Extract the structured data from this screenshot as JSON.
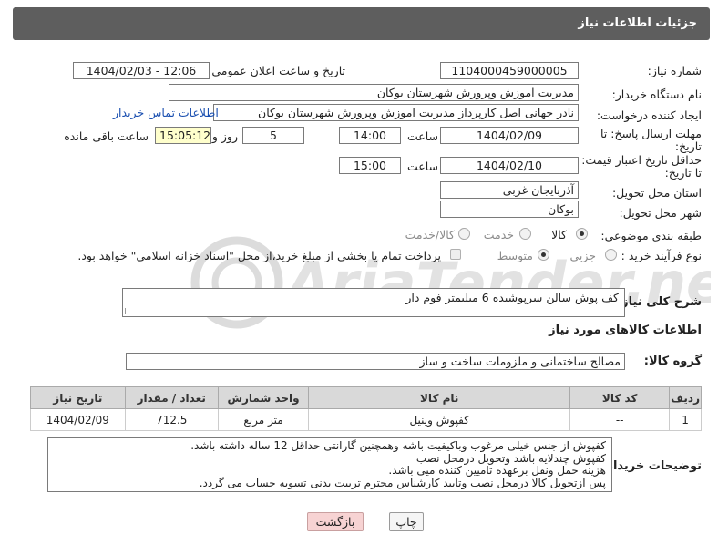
{
  "header": {
    "title": "جزئیات اطلاعات نیاز"
  },
  "form": {
    "need_number_label": "شماره نیاز:",
    "need_number": "1104000459000005",
    "announce_label": "تاریخ و ساعت اعلان عمومی:",
    "announce_value": "1404/02/03 - 12:06",
    "buyer_label": "نام دستگاه خریدار:",
    "buyer_value": "مدیریت اموزش وپرورش شهرستان بوکان",
    "creator_label": "ایجاد کننده درخواست:",
    "creator_value": "نادر جهانی اصل کارپرداز مدیریت اموزش وپرورش شهرستان بوکان",
    "contact_link": "اطلاعات تماس خریدار",
    "deadline_label_1": "مهلت ارسال پاسخ: تا",
    "deadline_label_2": "تاریخ:",
    "deadline_date": "1404/02/09",
    "time_label": "ساعت",
    "deadline_time": "14:00",
    "days_value": "5",
    "days_label": "روز و",
    "remaining_time": "15:05:12",
    "remaining_label": "ساعت باقی مانده",
    "validity_label_1": "حداقل تاریخ اعتبار قیمت:",
    "validity_label_2": "تا تاریخ:",
    "validity_date": "1404/02/10",
    "validity_time_label": "ساعت",
    "validity_time": "15:00",
    "province_label": "استان محل تحویل:",
    "province_value": "آذربایجان غربی",
    "city_label": "شهر محل تحویل:",
    "city_value": "بوکان",
    "category_label": "طبقه بندی موضوعی:",
    "category_options": [
      "کالا",
      "خدمت",
      "کالا/خدمت"
    ],
    "process_label": "نوع فرآیند خرید :",
    "process_options": [
      "جزیی",
      "متوسط"
    ],
    "payment_text": "پرداخت تمام یا بخشی از مبلغ خرید،از محل \"اسناد خزانه اسلامی\" خواهد بود.",
    "description_label": "شرح کلی نیاز:",
    "description_value": "کف پوش سالن سرپوشیده 6 میلیمتر فوم دار",
    "goods_info_title": "اطلاعات کالاهای مورد نیاز",
    "goods_group_label": "گروه کالا:",
    "goods_group_value": "مصالح ساختمانی و ملزومات ساخت و ساز"
  },
  "table": {
    "headers": [
      "ردیف",
      "کد کالا",
      "نام کالا",
      "واحد شمارش",
      "تعداد / مقدار",
      "تاریخ نیاز"
    ],
    "rows": [
      [
        "1",
        "--",
        "کفپوش وینیل",
        "متر مربع",
        "712.5",
        "1404/02/09"
      ]
    ]
  },
  "buyer_notes": {
    "label": "توضیحات خریدار:",
    "lines": [
      "کفپوش از جنس خیلی مرغوب وباکیفیت باشه وهمچنین گارانتی حداقل 12 ساله داشته باشد.",
      "کفپوش چندلایه باشد وتحویل درمحل نصب",
      "هزینه حمل ونقل برعهده تامیین کننده میی باشد.",
      "پس ازتحویل کالا درمحل نصب وتایید کارشناس محترم تربیت بدنی تسویه حساب می گردد."
    ]
  },
  "buttons": {
    "print": "چاپ",
    "back": "بازگشت"
  },
  "watermark": "AriaTender.net"
}
